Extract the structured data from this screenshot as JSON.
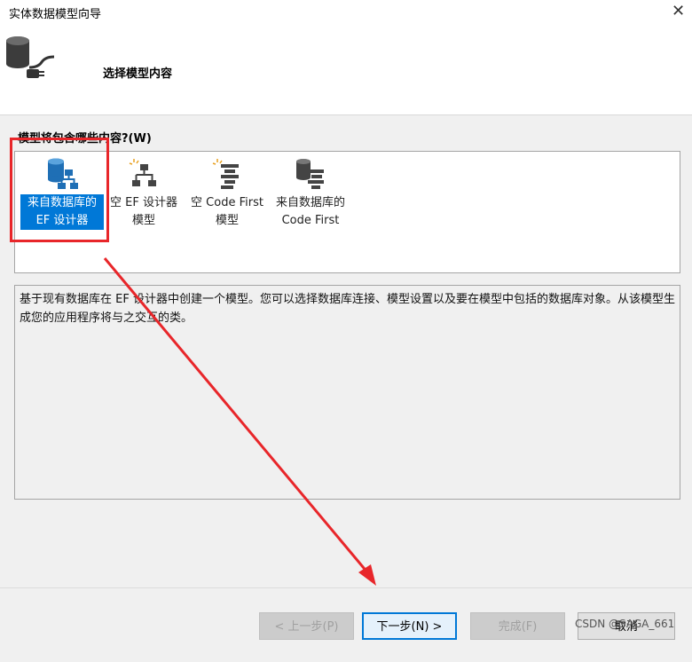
{
  "window": {
    "title": "实体数据模型向导"
  },
  "header": {
    "title": "选择模型内容",
    "icon": "database-plug-icon"
  },
  "section": {
    "label": "模型将包含哪些内容?(W)"
  },
  "model_options": [
    {
      "line1": "来自数据库的",
      "line2": "EF 设计器",
      "icon": "database-designer-icon",
      "selected": true
    },
    {
      "line1": "空 EF 设计器",
      "line2": "模型",
      "icon": "empty-designer-icon",
      "selected": false
    },
    {
      "line1": "空 Code First",
      "line2": "模型",
      "icon": "empty-code-first-icon",
      "selected": false
    },
    {
      "line1": "来自数据库的",
      "line2": "Code First",
      "icon": "database-code-first-icon",
      "selected": false
    }
  ],
  "description": "基于现有数据库在 EF 设计器中创建一个模型。您可以选择数据库连接、模型设置以及要在模型中包括的数据库对象。从该模型生成您的应用程序将与之交互的类。",
  "buttons": {
    "prev": "< 上一步(P)",
    "next": "下一步(N) >",
    "finish": "完成(F)",
    "cancel": "取消"
  },
  "watermark": "CSDN @SAGA_661",
  "colors": {
    "selection": "#0078d7",
    "annotation": "#e8262a",
    "content_bg": "#f0f0f0"
  }
}
